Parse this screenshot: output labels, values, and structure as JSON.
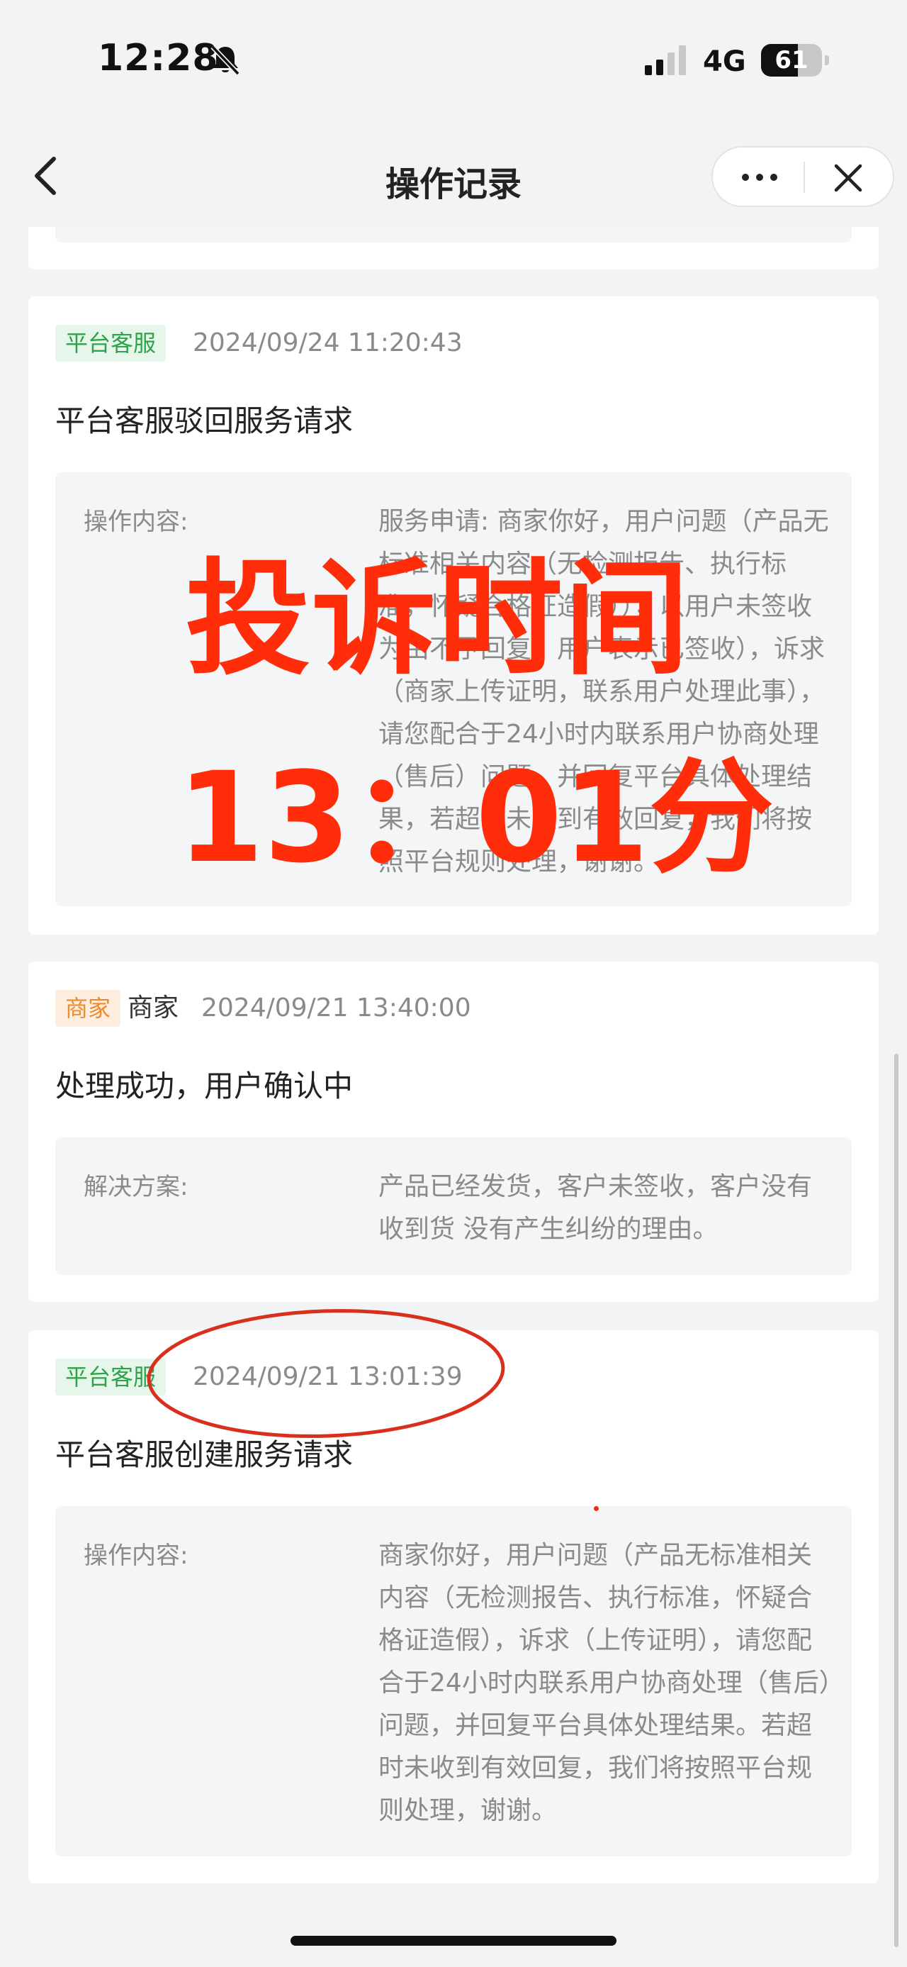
{
  "status_bar": {
    "time": "12:28",
    "network": "4G",
    "battery": "61",
    "battery_level": 0.61
  },
  "nav": {
    "title": "操作记录"
  },
  "records": [
    {
      "tag": "平台客服",
      "actor": "",
      "timestamp": "2024/09/24 11:20:43",
      "action": "平台客服驳回服务请求",
      "detail_label": "操作内容:",
      "detail_text": "服务申请: 商家你好，用户问题（产品无标准相关内容（无检测报告、执行标准，怀疑合格证造假）），以用户未签收为由不予回复，用户表示已签收），诉求（商家上传证明，联系用户处理此事），请您配合于24小时内联系用户协商处理（售后）问题，并回复平台具体处理结果，若超时未收到有效回复，我们将按照平台规则处理，谢谢。"
    },
    {
      "tag": "商家",
      "actor": "商家",
      "timestamp": "2024/09/21 13:40:00",
      "action": "处理成功，用户确认中",
      "detail_label": "解决方案:",
      "detail_text": "产品已经发货，客户未签收，客户没有收到货 没有产生纠纷的理由。"
    },
    {
      "tag": "平台客服",
      "actor": "",
      "timestamp": "2024/09/21 13:01:39",
      "action": "平台客服创建服务请求",
      "detail_label": "操作内容:",
      "detail_text": "商家你好，用户问题（产品无标准相关内容（无检测报告、执行标准，怀疑合格证造假），诉求（上传证明），请您配合于24小时内联系用户协商处理（售后）问题，并回复平台具体处理结果。若超时未收到有效回复，我们将按照平台规则处理，谢谢。"
    }
  ],
  "overlay": {
    "line1": "投诉时间",
    "line2": "13：01分"
  },
  "colors": {
    "accent_green": "#2ea34a",
    "accent_orange": "#ee8a2a",
    "overlay_red": "#ff2d0a"
  }
}
